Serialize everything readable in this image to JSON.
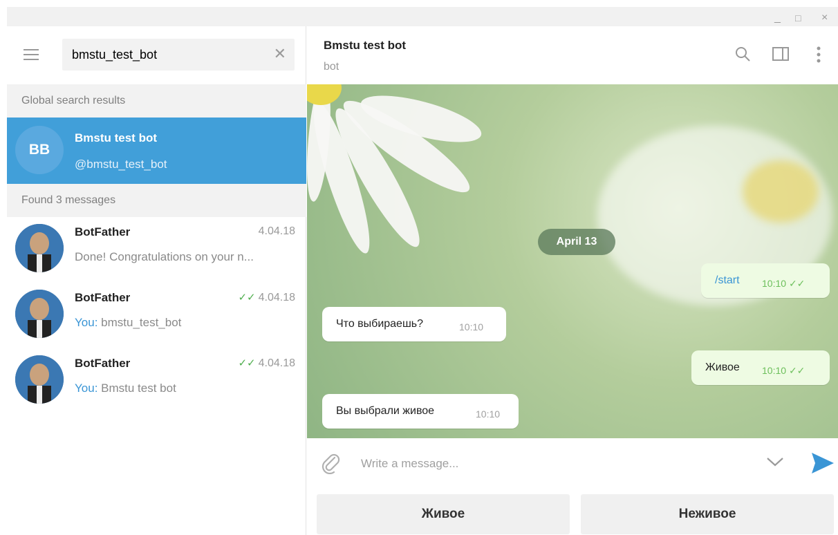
{
  "window": {
    "minimize": "_",
    "maximize": "□",
    "close": "×"
  },
  "sidebar": {
    "search": {
      "value": "bmstu_test_bot",
      "clear_icon": "close-icon"
    },
    "global_header": "Global search results",
    "global_result": {
      "initials": "BB",
      "name": "Bmstu test bot",
      "handle": "@bmstu_test_bot"
    },
    "found_header": "Found 3 messages",
    "messages": [
      {
        "name": "BotFather",
        "date": "4.04.18",
        "ticks": "",
        "you": "",
        "preview": "Done! Congratulations on your n..."
      },
      {
        "name": "BotFather",
        "date": "4.04.18",
        "ticks": "✓✓",
        "you": "You:",
        "preview": " bmstu_test_bot"
      },
      {
        "name": "BotFather",
        "date": "4.04.18",
        "ticks": "✓✓",
        "you": "You:",
        "preview": " Bmstu test bot"
      }
    ]
  },
  "chat": {
    "title": "Bmstu test bot",
    "subtitle": "bot",
    "date_pill": "April 13",
    "bubbles": [
      {
        "text": "/start",
        "time": "10:10",
        "ticks": "✓✓"
      },
      {
        "text": "Что выбираешь?",
        "time": "10:10"
      },
      {
        "text": "Живое",
        "time": "10:10",
        "ticks": "✓✓"
      },
      {
        "text": "Вы выбрали живое",
        "time": "10:10"
      }
    ],
    "composer_placeholder": "Write a message...",
    "keyboard": [
      "Живое",
      "Неживое"
    ]
  },
  "colors": {
    "accent": "#419fd9",
    "out_bubble": "#eefbe3",
    "read_ticks": "#4fae4e"
  }
}
